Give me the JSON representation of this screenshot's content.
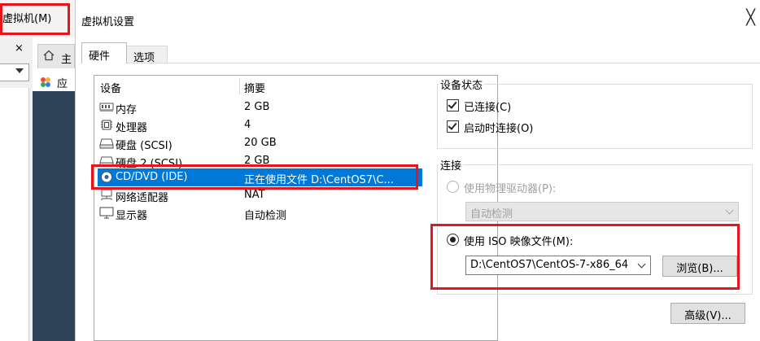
{
  "background": {
    "menu_vm": "虚拟机(M)",
    "left_close": "×",
    "tab_home": "主",
    "apps_label": "应",
    "dark_color": "#2e4358"
  },
  "dialog": {
    "title": "虚拟机设置",
    "close_glyph": "╳",
    "tabs": [
      {
        "label": "硬件",
        "active": true
      },
      {
        "label": "选项",
        "active": false
      }
    ],
    "device_list": {
      "header_device": "设备",
      "header_summary": "摘要",
      "rows": [
        {
          "icon": "memory-icon",
          "name": "内存",
          "summary": "2 GB"
        },
        {
          "icon": "cpu-icon",
          "name": "处理器",
          "summary": "4"
        },
        {
          "icon": "hard-disk-icon",
          "name": "硬盘 (SCSI)",
          "summary": "20 GB"
        },
        {
          "icon": "hard-disk-icon",
          "name": "硬盘 2 (SCSI)",
          "summary": "2 GB"
        },
        {
          "icon": "cd-dvd-icon",
          "name": "CD/DVD (IDE)",
          "summary": "正在使用文件 D:\\CentOS7\\C..."
        },
        {
          "icon": "network-adapter-icon",
          "name": "网络适配器",
          "summary": "NAT"
        },
        {
          "icon": "display-icon",
          "name": "显示器",
          "summary": "自动检测"
        }
      ],
      "selected_index": 4
    },
    "device_status": {
      "label": "设备状态",
      "connected_label": "已连接(C)",
      "connected_checked": true,
      "connect_at_power_on_label": "启动时连接(O)",
      "connect_at_power_on_checked": true
    },
    "connection": {
      "label": "连接",
      "physical_drive_label": "使用物理驱动器(P):",
      "physical_drive_value": "自动检测",
      "iso_label": "使用 ISO 映像文件(M):",
      "iso_value": "D:\\CentOS7\\CentOS-7-x86_64",
      "browse_label": "浏览(B)..."
    },
    "advanced_label": "高级(V)...",
    "selection_color": "#0078d7",
    "highlight_color": "#e8141c"
  }
}
